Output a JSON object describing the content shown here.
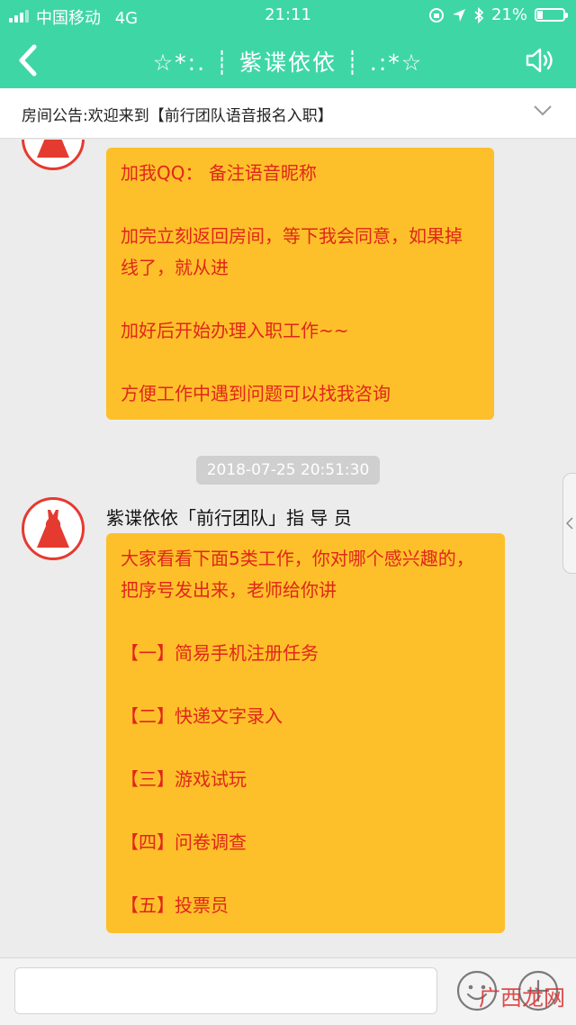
{
  "status_bar": {
    "carrier": "中国移动",
    "network": "4G",
    "time": "21:11",
    "battery": "21%",
    "battery_level": 0.21
  },
  "nav": {
    "title": "☆*:. ┊ 紫谍依依 ┊ .:*☆",
    "back_icon": "chevron-left-icon",
    "speaker_icon": "speaker-icon"
  },
  "announcement": {
    "text": "房间公告:欢迎来到【前行团队语音报名入职】",
    "expand_icon": "chevron-down-icon"
  },
  "messages": [
    {
      "lines": [
        "加我QQ：                    备注语音昵称",
        "",
        "加完立刻返回房间，等下我会同意，如果掉线了，就从进",
        "",
        "加好后开始办理入职工作~~",
        "",
        "方便工作中遇到问题可以找我咨询"
      ]
    },
    {
      "timestamp": "2018-07-25 20:51:30",
      "sender": "紫谍依依「前行团队」指 导 员",
      "lines": [
        "大家看看下面5类工作，你对哪个感兴趣的，把序号发出来，老师给你讲",
        "",
        "【一】简易手机注册任务",
        "",
        "【二】快递文字录入",
        "",
        "【三】游戏试玩",
        "",
        "【四】问卷调查",
        "",
        "【五】投票员"
      ]
    }
  ],
  "input": {
    "value": "",
    "emoji_icon": "emoji-icon",
    "plus_icon": "plus-icon"
  },
  "watermark": "广西龙网",
  "colors": {
    "header": "#3fd6a6",
    "bubble": "#fdc02a",
    "bubble_text": "#e0261b",
    "avatar_border": "#e53a30"
  }
}
